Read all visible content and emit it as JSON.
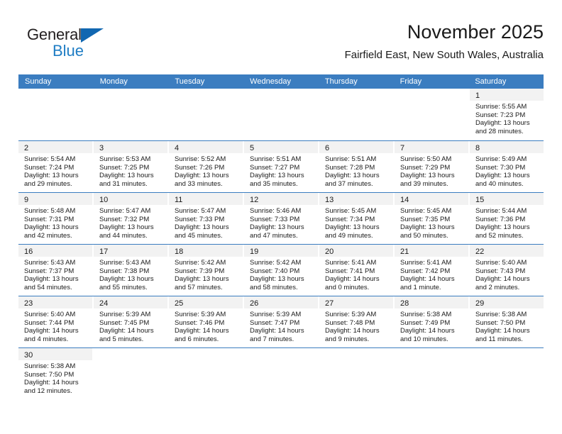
{
  "brand": {
    "name_part1": "General",
    "name_part2": "Blue",
    "triangle_icon": "triangle-icon",
    "color_dark": "#231f20",
    "color_blue": "#1f7dc4"
  },
  "header": {
    "title": "November 2025",
    "subtitle": "Fairfield East, New South Wales, Australia"
  },
  "theme": {
    "header_blue": "#3b7dc0",
    "row_divider": "#3b7dc0",
    "daynum_band": "#f2f2f2",
    "text": "#1a1a1a"
  },
  "calendar": {
    "weekday_headers": [
      "Sunday",
      "Monday",
      "Tuesday",
      "Wednesday",
      "Thursday",
      "Friday",
      "Saturday"
    ],
    "weeks": [
      [
        {
          "blank": true
        },
        {
          "blank": true
        },
        {
          "blank": true
        },
        {
          "blank": true
        },
        {
          "blank": true
        },
        {
          "blank": true
        },
        {
          "day": "1",
          "sunrise": "Sunrise: 5:55 AM",
          "sunset": "Sunset: 7:23 PM",
          "daylight1": "Daylight: 13 hours",
          "daylight2": "and 28 minutes."
        }
      ],
      [
        {
          "day": "2",
          "sunrise": "Sunrise: 5:54 AM",
          "sunset": "Sunset: 7:24 PM",
          "daylight1": "Daylight: 13 hours",
          "daylight2": "and 29 minutes."
        },
        {
          "day": "3",
          "sunrise": "Sunrise: 5:53 AM",
          "sunset": "Sunset: 7:25 PM",
          "daylight1": "Daylight: 13 hours",
          "daylight2": "and 31 minutes."
        },
        {
          "day": "4",
          "sunrise": "Sunrise: 5:52 AM",
          "sunset": "Sunset: 7:26 PM",
          "daylight1": "Daylight: 13 hours",
          "daylight2": "and 33 minutes."
        },
        {
          "day": "5",
          "sunrise": "Sunrise: 5:51 AM",
          "sunset": "Sunset: 7:27 PM",
          "daylight1": "Daylight: 13 hours",
          "daylight2": "and 35 minutes."
        },
        {
          "day": "6",
          "sunrise": "Sunrise: 5:51 AM",
          "sunset": "Sunset: 7:28 PM",
          "daylight1": "Daylight: 13 hours",
          "daylight2": "and 37 minutes."
        },
        {
          "day": "7",
          "sunrise": "Sunrise: 5:50 AM",
          "sunset": "Sunset: 7:29 PM",
          "daylight1": "Daylight: 13 hours",
          "daylight2": "and 39 minutes."
        },
        {
          "day": "8",
          "sunrise": "Sunrise: 5:49 AM",
          "sunset": "Sunset: 7:30 PM",
          "daylight1": "Daylight: 13 hours",
          "daylight2": "and 40 minutes."
        }
      ],
      [
        {
          "day": "9",
          "sunrise": "Sunrise: 5:48 AM",
          "sunset": "Sunset: 7:31 PM",
          "daylight1": "Daylight: 13 hours",
          "daylight2": "and 42 minutes."
        },
        {
          "day": "10",
          "sunrise": "Sunrise: 5:47 AM",
          "sunset": "Sunset: 7:32 PM",
          "daylight1": "Daylight: 13 hours",
          "daylight2": "and 44 minutes."
        },
        {
          "day": "11",
          "sunrise": "Sunrise: 5:47 AM",
          "sunset": "Sunset: 7:33 PM",
          "daylight1": "Daylight: 13 hours",
          "daylight2": "and 45 minutes."
        },
        {
          "day": "12",
          "sunrise": "Sunrise: 5:46 AM",
          "sunset": "Sunset: 7:33 PM",
          "daylight1": "Daylight: 13 hours",
          "daylight2": "and 47 minutes."
        },
        {
          "day": "13",
          "sunrise": "Sunrise: 5:45 AM",
          "sunset": "Sunset: 7:34 PM",
          "daylight1": "Daylight: 13 hours",
          "daylight2": "and 49 minutes."
        },
        {
          "day": "14",
          "sunrise": "Sunrise: 5:45 AM",
          "sunset": "Sunset: 7:35 PM",
          "daylight1": "Daylight: 13 hours",
          "daylight2": "and 50 minutes."
        },
        {
          "day": "15",
          "sunrise": "Sunrise: 5:44 AM",
          "sunset": "Sunset: 7:36 PM",
          "daylight1": "Daylight: 13 hours",
          "daylight2": "and 52 minutes."
        }
      ],
      [
        {
          "day": "16",
          "sunrise": "Sunrise: 5:43 AM",
          "sunset": "Sunset: 7:37 PM",
          "daylight1": "Daylight: 13 hours",
          "daylight2": "and 54 minutes."
        },
        {
          "day": "17",
          "sunrise": "Sunrise: 5:43 AM",
          "sunset": "Sunset: 7:38 PM",
          "daylight1": "Daylight: 13 hours",
          "daylight2": "and 55 minutes."
        },
        {
          "day": "18",
          "sunrise": "Sunrise: 5:42 AM",
          "sunset": "Sunset: 7:39 PM",
          "daylight1": "Daylight: 13 hours",
          "daylight2": "and 57 minutes."
        },
        {
          "day": "19",
          "sunrise": "Sunrise: 5:42 AM",
          "sunset": "Sunset: 7:40 PM",
          "daylight1": "Daylight: 13 hours",
          "daylight2": "and 58 minutes."
        },
        {
          "day": "20",
          "sunrise": "Sunrise: 5:41 AM",
          "sunset": "Sunset: 7:41 PM",
          "daylight1": "Daylight: 14 hours",
          "daylight2": "and 0 minutes."
        },
        {
          "day": "21",
          "sunrise": "Sunrise: 5:41 AM",
          "sunset": "Sunset: 7:42 PM",
          "daylight1": "Daylight: 14 hours",
          "daylight2": "and 1 minute."
        },
        {
          "day": "22",
          "sunrise": "Sunrise: 5:40 AM",
          "sunset": "Sunset: 7:43 PM",
          "daylight1": "Daylight: 14 hours",
          "daylight2": "and 2 minutes."
        }
      ],
      [
        {
          "day": "23",
          "sunrise": "Sunrise: 5:40 AM",
          "sunset": "Sunset: 7:44 PM",
          "daylight1": "Daylight: 14 hours",
          "daylight2": "and 4 minutes."
        },
        {
          "day": "24",
          "sunrise": "Sunrise: 5:39 AM",
          "sunset": "Sunset: 7:45 PM",
          "daylight1": "Daylight: 14 hours",
          "daylight2": "and 5 minutes."
        },
        {
          "day": "25",
          "sunrise": "Sunrise: 5:39 AM",
          "sunset": "Sunset: 7:46 PM",
          "daylight1": "Daylight: 14 hours",
          "daylight2": "and 6 minutes."
        },
        {
          "day": "26",
          "sunrise": "Sunrise: 5:39 AM",
          "sunset": "Sunset: 7:47 PM",
          "daylight1": "Daylight: 14 hours",
          "daylight2": "and 7 minutes."
        },
        {
          "day": "27",
          "sunrise": "Sunrise: 5:39 AM",
          "sunset": "Sunset: 7:48 PM",
          "daylight1": "Daylight: 14 hours",
          "daylight2": "and 9 minutes."
        },
        {
          "day": "28",
          "sunrise": "Sunrise: 5:38 AM",
          "sunset": "Sunset: 7:49 PM",
          "daylight1": "Daylight: 14 hours",
          "daylight2": "and 10 minutes."
        },
        {
          "day": "29",
          "sunrise": "Sunrise: 5:38 AM",
          "sunset": "Sunset: 7:50 PM",
          "daylight1": "Daylight: 14 hours",
          "daylight2": "and 11 minutes."
        }
      ],
      [
        {
          "day": "30",
          "sunrise": "Sunrise: 5:38 AM",
          "sunset": "Sunset: 7:50 PM",
          "daylight1": "Daylight: 14 hours",
          "daylight2": "and 12 minutes."
        },
        {
          "blank": true
        },
        {
          "blank": true
        },
        {
          "blank": true
        },
        {
          "blank": true
        },
        {
          "blank": true
        },
        {
          "blank": true
        }
      ]
    ]
  }
}
